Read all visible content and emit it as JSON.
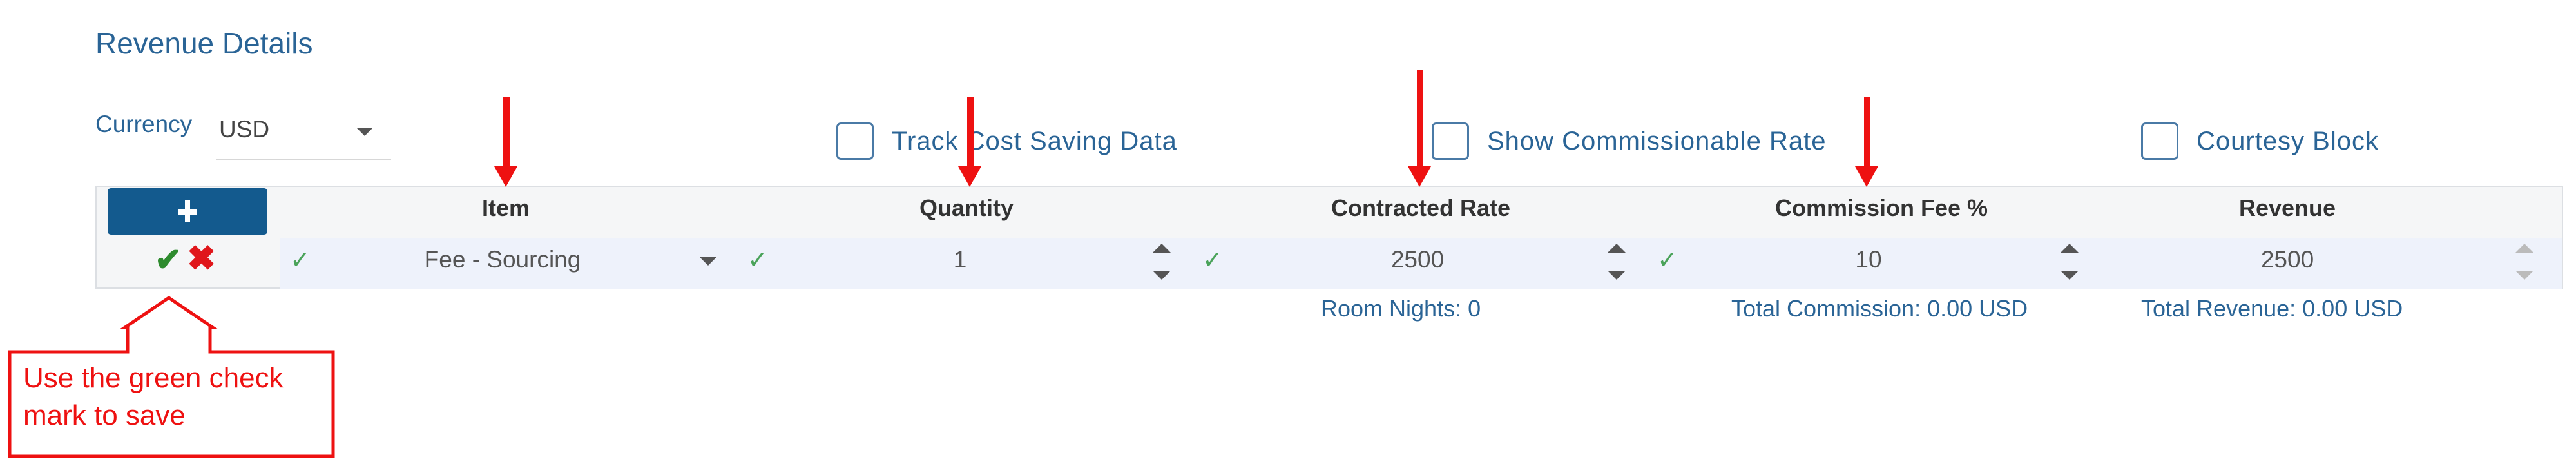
{
  "section": {
    "title": "Revenue Details"
  },
  "currency": {
    "label": "Currency",
    "value": "USD"
  },
  "options": {
    "track_cost_saving": {
      "label": "Track Cost Saving Data",
      "checked": false
    },
    "show_commissionable_rate": {
      "label": "Show Commissionable Rate",
      "checked": false
    },
    "courtesy_block": {
      "label": "Courtesy Block",
      "checked": false
    }
  },
  "grid": {
    "add_icon": "plus-icon",
    "add_glyph": "+",
    "columns": [
      "Item",
      "Quantity",
      "Contracted Rate",
      "Commission Fee %",
      "Revenue"
    ],
    "row": {
      "save_glyph": "✔",
      "cancel_glyph": "✖",
      "valid_glyph": "✓",
      "item": "Fee - Sourcing",
      "quantity": "1",
      "contracted_rate": "2500",
      "commission_fee": "10",
      "revenue": "2500"
    }
  },
  "summary": {
    "room_nights": "Room Nights: 0",
    "total_commission": "Total Commission: 0.00 USD",
    "total_revenue": "Total Revenue: 0.00 USD"
  },
  "annotation": {
    "callout_text": "Use the green check mark to save",
    "color": "#ee1111"
  },
  "colors": {
    "accent": "#2a6496",
    "add_button": "#135a8e",
    "save": "#2e8b2e",
    "cancel": "#e0161b",
    "valid": "#4aa35a"
  }
}
